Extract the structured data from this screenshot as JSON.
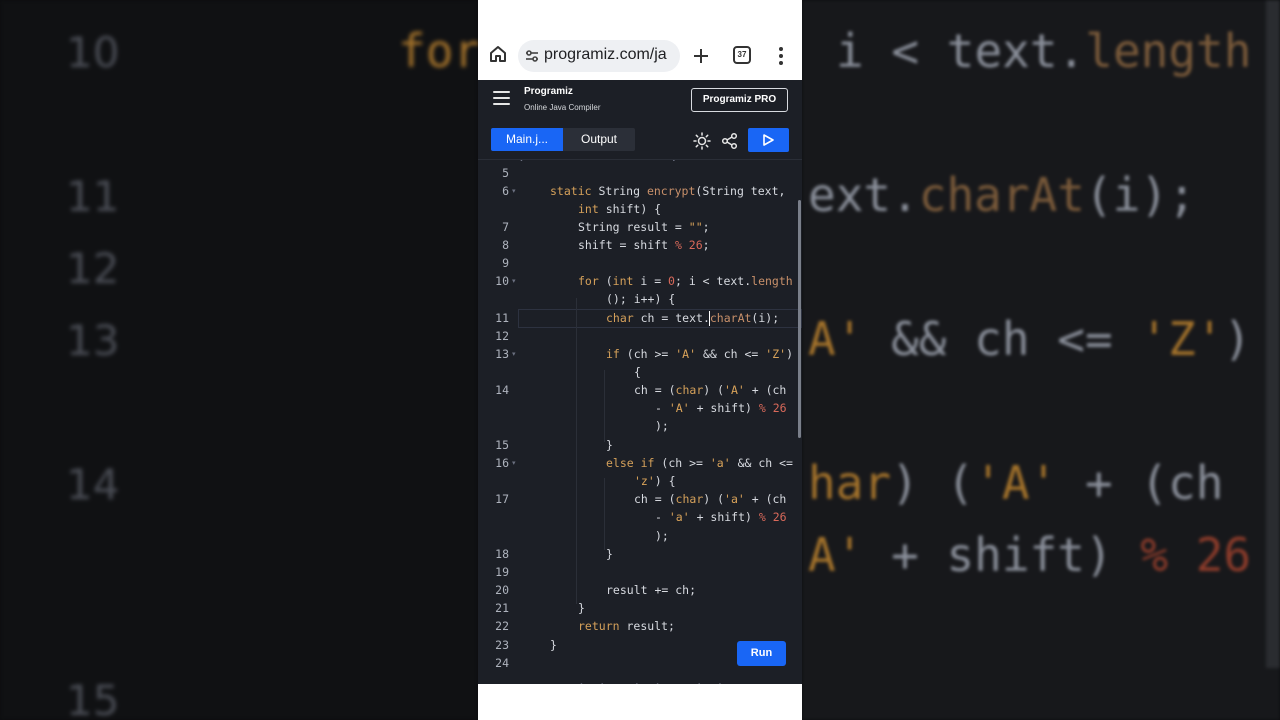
{
  "browser": {
    "url": "programiz.com/ja",
    "tab_count": "37"
  },
  "site": {
    "logo": "Programiz",
    "subtitle": "Online Java Compiler",
    "pro_button": "Programiz PRO"
  },
  "tabs": {
    "main": "Main.j...",
    "output": "Output"
  },
  "run_button": "Run",
  "gutter": [
    "5",
    "6",
    "7",
    "8",
    "9",
    "10",
    "11",
    "12",
    "13",
    "14",
    "15",
    "16",
    "17",
    "18",
    "19",
    "20",
    "21",
    "22",
    "23",
    "24"
  ],
  "background": {
    "line_numbers": [
      "10",
      "11",
      "12",
      "13",
      "14",
      "15"
    ],
    "code": [
      "for ( i < text.length",
      "ext.charAt(i);",
      "'A' && ch <= 'Z')",
      "har) ('A' + (ch",
      "' + shift) % 26"
    ]
  },
  "colors": {
    "accent": "#1966f5",
    "editor_bg": "#1c1f26",
    "keyword": "#d4a05a",
    "number": "#d9695a"
  }
}
